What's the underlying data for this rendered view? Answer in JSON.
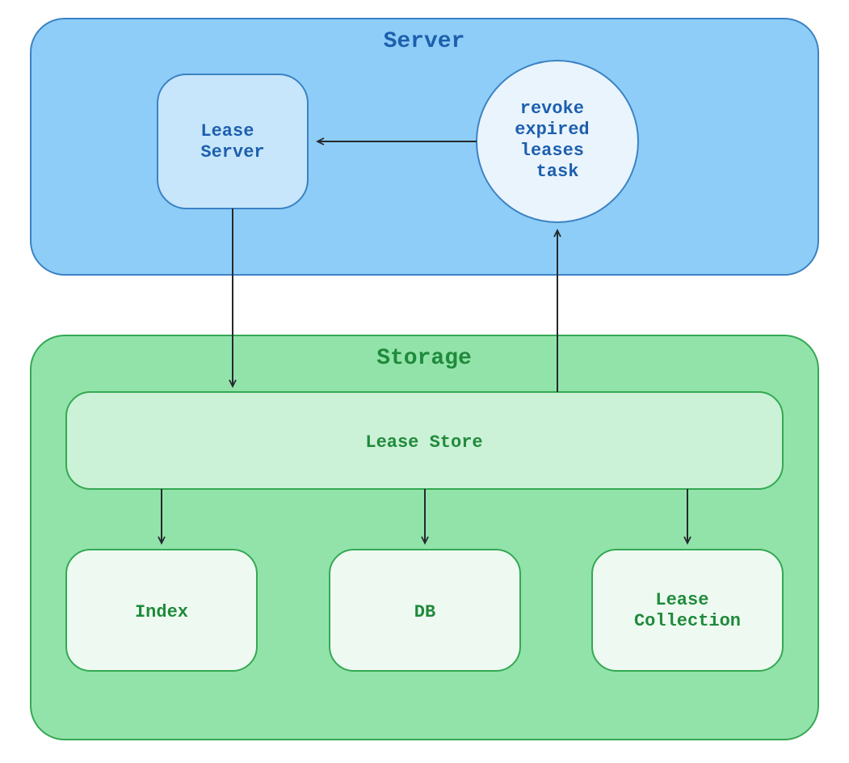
{
  "colors": {
    "server_fill": "#8ecdf7",
    "server_stroke": "#3b82c4",
    "server_text": "#1d5fae",
    "server_node_fill": "#c7e6fb",
    "revoke_fill": "#eaf4fd",
    "storage_fill": "#92e3a9",
    "storage_stroke": "#34a853",
    "storage_text": "#1f8a3b",
    "storage_node_fill": "#cbf1d6",
    "storage_leaf_fill": "#eefaf1",
    "arrow": "#24292e"
  },
  "groups": {
    "server": {
      "title": "Server"
    },
    "storage": {
      "title": "Storage"
    }
  },
  "nodes": {
    "lease_server": {
      "label": "Lease Server"
    },
    "revoke_task": {
      "label": "revoke expired leases task"
    },
    "lease_store": {
      "label": "Lease Store"
    },
    "index": {
      "label": "Index"
    },
    "db": {
      "label": "DB"
    },
    "lease_coll": {
      "label": "Lease Collection"
    }
  },
  "edges": [
    {
      "from": "revoke_task",
      "to": "lease_server"
    },
    {
      "from": "lease_server",
      "to": "lease_store"
    },
    {
      "from": "lease_store",
      "to": "revoke_task"
    },
    {
      "from": "lease_store",
      "to": "index"
    },
    {
      "from": "lease_store",
      "to": "db"
    },
    {
      "from": "lease_store",
      "to": "lease_coll"
    }
  ]
}
